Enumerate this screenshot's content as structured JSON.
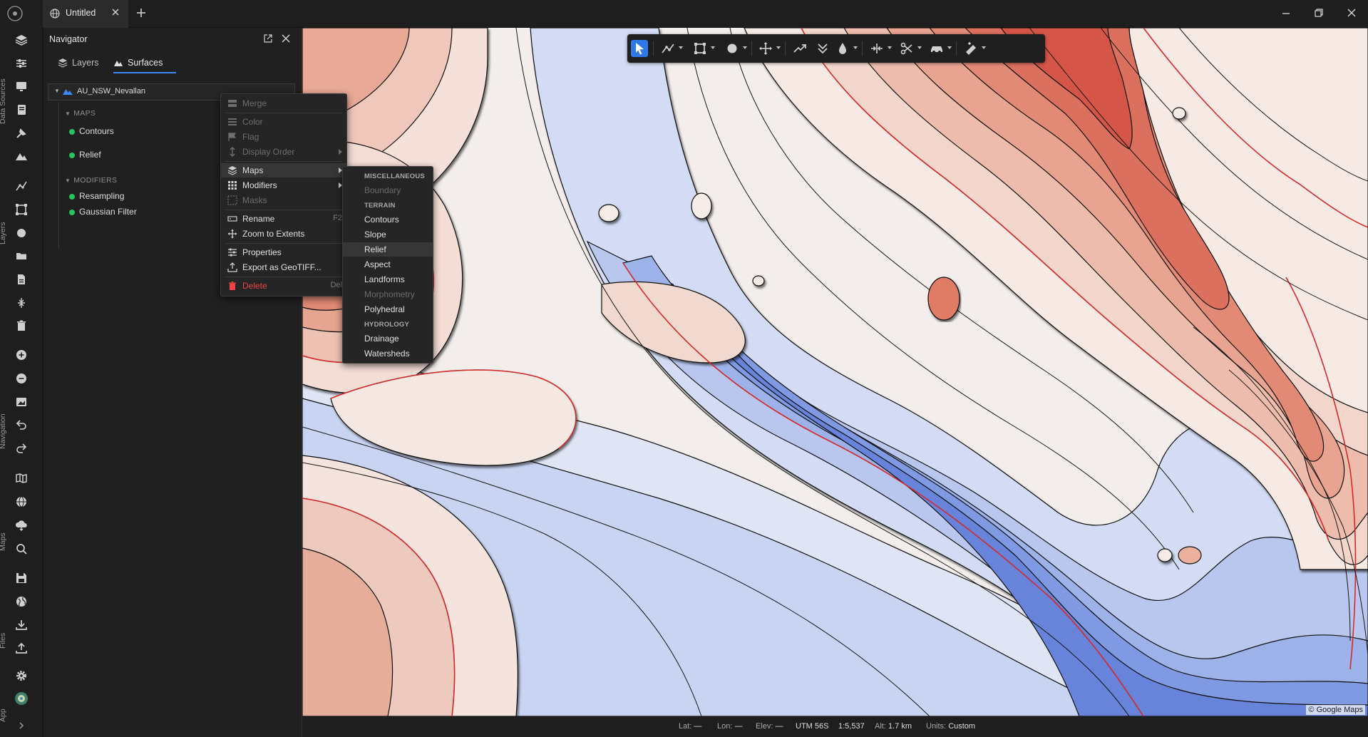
{
  "titlebar": {
    "tab_title": "Untitled"
  },
  "sidebar": {
    "sections": [
      "Data Sources",
      "Layers",
      "Navigation",
      "Maps",
      "Files",
      "App"
    ]
  },
  "navigator": {
    "title": "Navigator",
    "tabs": [
      {
        "label": "Layers",
        "active": false
      },
      {
        "label": "Surfaces",
        "active": true
      }
    ],
    "surface_name": "AU_NSW_Nevallan",
    "groups": [
      {
        "label": "MAPS",
        "items": [
          "Contours",
          "Relief"
        ]
      },
      {
        "label": "MODIFIERS",
        "items": [
          "Resampling",
          "Gaussian Filter"
        ]
      }
    ]
  },
  "context_menu": {
    "items": [
      {
        "label": "Merge",
        "icon": "merge-icon",
        "disabled": true
      },
      {
        "label": "Color",
        "icon": "palette-icon",
        "disabled": true
      },
      {
        "label": "Flag",
        "icon": "flag-icon",
        "disabled": true
      },
      {
        "label": "Display Order",
        "icon": "display-order-icon",
        "disabled": true,
        "submenu": true
      },
      {
        "label": "Maps",
        "icon": "maps-icon",
        "highlighted": true,
        "submenu": true
      },
      {
        "label": "Modifiers",
        "icon": "modifiers-icon",
        "submenu": true
      },
      {
        "label": "Masks",
        "icon": "masks-icon",
        "disabled": true
      },
      {
        "label": "Rename",
        "icon": "rename-icon",
        "shortcut": "F2"
      },
      {
        "label": "Zoom to Extents",
        "icon": "zoom-extents-icon"
      },
      {
        "label": "Properties",
        "icon": "properties-icon"
      },
      {
        "label": "Export as GeoTIFF...",
        "icon": "export-icon"
      },
      {
        "label": "Delete",
        "icon": "trash-icon",
        "shortcut": "Del",
        "danger": true
      }
    ]
  },
  "maps_submenu": {
    "sections": [
      {
        "header": "MISCELLANEOUS",
        "items": [
          {
            "label": "Boundary",
            "disabled": true
          }
        ]
      },
      {
        "header": "TERRAIN",
        "items": [
          {
            "label": "Contours"
          },
          {
            "label": "Slope"
          },
          {
            "label": "Relief",
            "highlighted": true
          },
          {
            "label": "Aspect"
          },
          {
            "label": "Landforms"
          },
          {
            "label": "Morphometry",
            "disabled": true
          },
          {
            "label": "Polyhedral"
          }
        ]
      },
      {
        "header": "HYDROLOGY",
        "items": [
          {
            "label": "Drainage"
          },
          {
            "label": "Watersheds"
          }
        ]
      }
    ]
  },
  "map": {
    "attribution": "© Google Maps",
    "toolbar_tools": [
      "select-arrow-icon",
      "polyline-icon",
      "bounding-box-icon",
      "circle-icon",
      "move-icon",
      "trend-line-icon",
      "double-chevron-down-icon",
      "drop-icon",
      "split-horizontal-icon",
      "scissors-icon",
      "car-icon",
      "measure-icon"
    ]
  },
  "status": {
    "lat_label": "Lat:",
    "lat_value": "—",
    "lon_label": "Lon:",
    "lon_value": "—",
    "elev_label": "Elev:",
    "elev_value": "—",
    "crs": "UTM 56S",
    "scale": "1:5,537",
    "alt_label": "Alt:",
    "alt_value": "1.7 km",
    "units_label": "Units:",
    "units_value": "Custom"
  },
  "colors": {
    "accent": "#3d8af7",
    "layer_active_dot": "#22c55e",
    "delete_red": "#ef4444",
    "map_high": "#d9474c",
    "map_low": "#4a6fdc"
  }
}
